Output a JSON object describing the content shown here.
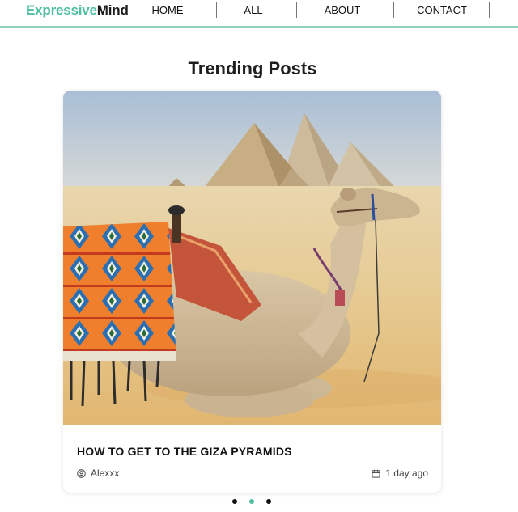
{
  "brand": {
    "name_accent": "Expressive",
    "name_rest": "Mind"
  },
  "nav": {
    "items": [
      {
        "label": "HOME"
      },
      {
        "label": "ALL"
      },
      {
        "label": "ABOUT"
      },
      {
        "label": "CONTACT"
      }
    ]
  },
  "section": {
    "title": "Trending Posts"
  },
  "post": {
    "title": "HOW TO GET TO THE GIZA PYRAMIDS",
    "author": "Alexxx",
    "date": "1 day ago",
    "image_subject": "camel resting in front of the Giza pyramids"
  },
  "carousel": {
    "total": 3,
    "active_index": 1
  },
  "colors": {
    "accent": "#4fbf9f",
    "header_line": "#8fd3bd",
    "text": "#1f1f1f"
  },
  "icons": {
    "author": "user-circle-icon",
    "date": "calendar-icon"
  }
}
